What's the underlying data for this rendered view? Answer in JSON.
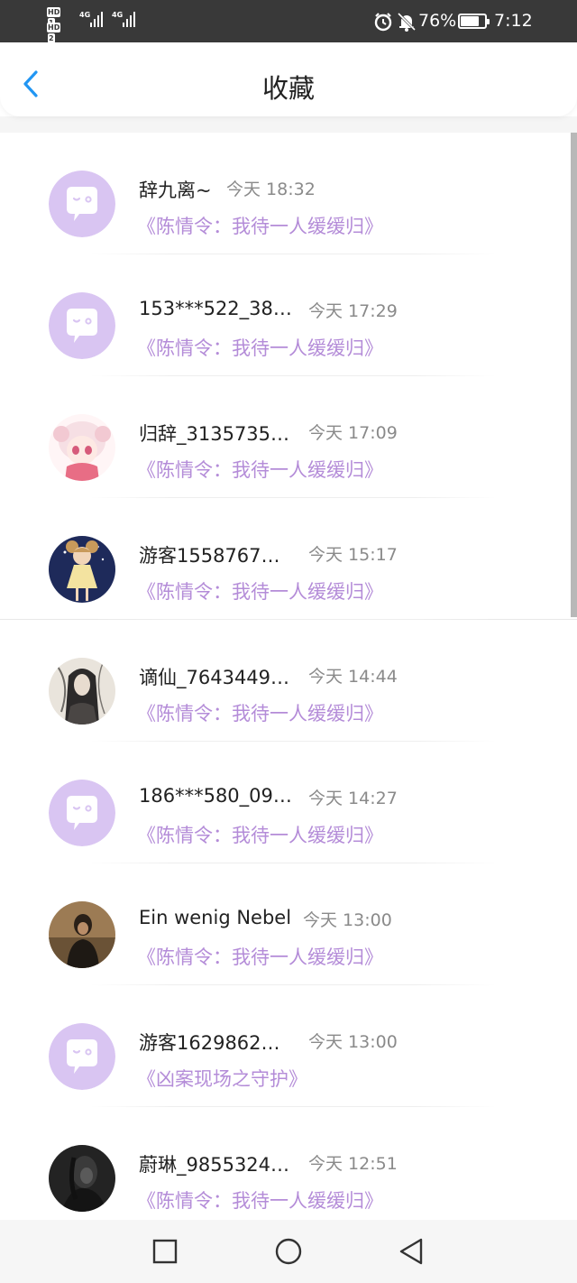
{
  "status_bar": {
    "sim1_label": "HD",
    "sim1_number": "1",
    "sim2_label": "HD",
    "sim2_number": "2",
    "net1": "4G",
    "net2": "4G",
    "battery": "76%",
    "battery_level": 0.76,
    "time": "7:12"
  },
  "header": {
    "title": "收藏"
  },
  "items": [
    {
      "username": "辞九离~",
      "time": "今天 18:32",
      "book": "《陈情令：我待一人缓缓归》",
      "avatar": "default-chat-avatar"
    },
    {
      "username": "153***522_38…",
      "time": "今天 17:29",
      "book": "《陈情令：我待一人缓缓归》",
      "avatar": "default-chat-avatar"
    },
    {
      "username": "归辞_3135735…",
      "time": "今天 17:09",
      "book": "《陈情令：我待一人缓缓归》",
      "avatar": "anime-girl-pink-avatar"
    },
    {
      "username": "游客1558767…",
      "time": "今天 15:17",
      "book": "《陈情令：我待一人缓缓归》",
      "avatar": "anime-girl-night-avatar"
    },
    {
      "username": "谪仙_7643449…",
      "time": "今天 14:44",
      "book": "《陈情令：我待一人缓缓归》",
      "avatar": "ink-portrait-avatar"
    },
    {
      "username": "186***580_09…",
      "time": "今天 14:27",
      "book": "《陈情令：我待一人缓缓归》",
      "avatar": "default-chat-avatar"
    },
    {
      "username": "Ein wenig Nebel",
      "time": "今天 13:00",
      "book": "《陈情令：我待一人缓缓归》",
      "avatar": "photo-person-avatar"
    },
    {
      "username": "游客1629862…",
      "time": "今天 13:00",
      "book": "《凶案现场之守护》",
      "avatar": "default-chat-avatar"
    },
    {
      "username": "蔚琳_9855324…",
      "time": "今天 12:51",
      "book": "《陈情令：我待一人缓缓归》",
      "avatar": "dark-portrait-avatar"
    }
  ],
  "nav_bar": {
    "icons": [
      "square-icon",
      "circle-icon",
      "triangle-back-icon"
    ]
  },
  "colors": {
    "accent_purple": "#b48cd8",
    "avatar_purple": "#d9c5f2",
    "back_blue": "#2196f3"
  }
}
